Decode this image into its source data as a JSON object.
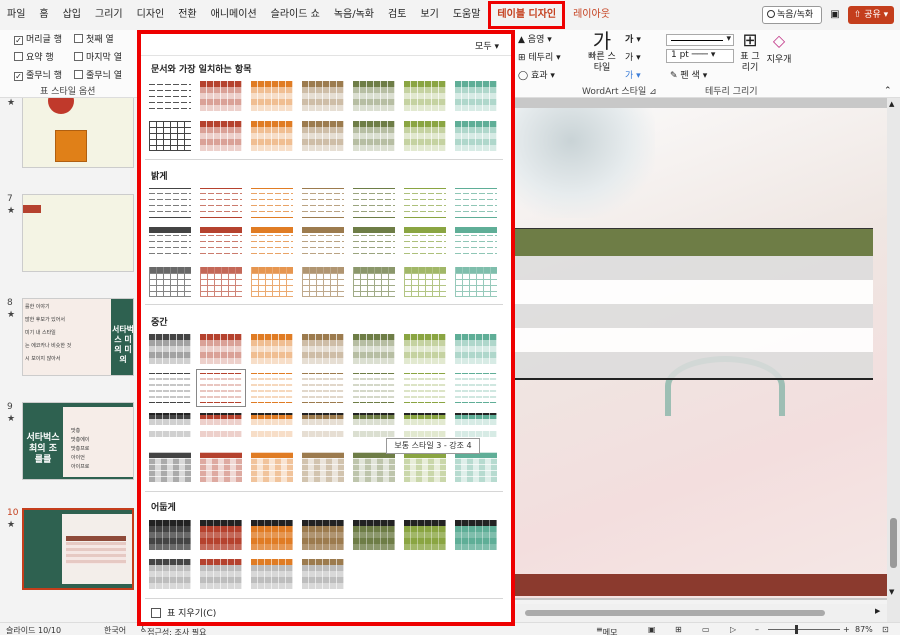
{
  "tabs": [
    {
      "label": "파일"
    },
    {
      "label": "홈"
    },
    {
      "label": "삽입"
    },
    {
      "label": "그리기"
    },
    {
      "label": "디자인"
    },
    {
      "label": "전환"
    },
    {
      "label": "애니메이션"
    },
    {
      "label": "슬라이드 쇼"
    },
    {
      "label": "녹음/녹화"
    },
    {
      "label": "검토"
    },
    {
      "label": "보기"
    },
    {
      "label": "도움말"
    },
    {
      "label": "테이블 디자인"
    },
    {
      "label": "레이아웃"
    }
  ],
  "titlebar": {
    "record_label": "녹음/녹화",
    "share_label": "공유",
    "camera_icon": "camera-icon"
  },
  "style_options": {
    "items": [
      {
        "label": "머리글 행",
        "checked": true
      },
      {
        "label": "첫째 열",
        "checked": false
      },
      {
        "label": "요약 행",
        "checked": false
      },
      {
        "label": "마지막 열",
        "checked": false
      },
      {
        "label": "줄무늬 행",
        "checked": true
      },
      {
        "label": "줄무늬 열",
        "checked": false
      }
    ],
    "group_label": "표 스타일 옵션"
  },
  "ribbon": {
    "shading": "음영",
    "borders": "테두리",
    "effects": "효과",
    "quick_styles": "빠른 스타일",
    "wordart_group": "WordArt 스타일",
    "pen_weight": "1 pt",
    "pen_color": "펜 색",
    "draw_table": "표 그리기",
    "eraser": "지우개",
    "draw_borders_group": "테두리 그리기"
  },
  "gallery": {
    "all_label": "모두",
    "sections": [
      {
        "title": "문서와 가장 일치하는 항목"
      },
      {
        "title": "밝게"
      },
      {
        "title": "중간"
      },
      {
        "title": "어둡게"
      }
    ],
    "tooltip": "보통 스타일 3 - 강조 4",
    "clear_label": "표 지우기(C)",
    "colors": [
      "#444444",
      "#b5422e",
      "#e07c24",
      "#9c7b4e",
      "#6e7d46",
      "#8aa542",
      "#5fae97"
    ]
  },
  "slides": [
    {
      "num": "7"
    },
    {
      "num": "8"
    },
    {
      "num": "9"
    },
    {
      "num": "10"
    }
  ],
  "slide8_text": [
    "를한 이야기",
    "많한 후보가 있어서",
    "미기 내 스타일",
    "는 에코카나 비슷한 것",
    "시 보이지 않아서"
  ],
  "slide8_title": "서타벅스 미의 미의",
  "slide9_text": [
    "맛층",
    "맛층에이",
    "맛층프로",
    "아이언",
    "아이프로"
  ],
  "slide9_title": "서타벅스 최의 조를를",
  "status": {
    "slide": "슬라이드 10/10",
    "language": "한국어",
    "accessibility": "접근성: 조사 필요",
    "notes": "메모",
    "zoom": "87%"
  }
}
